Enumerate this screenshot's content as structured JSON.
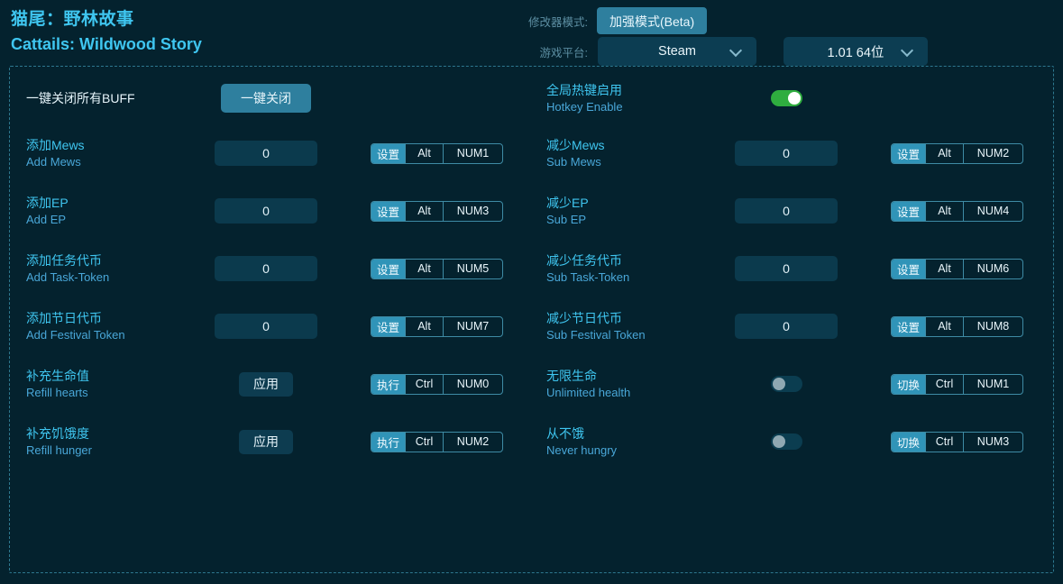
{
  "window": {
    "title_cn": "猫尾：野林故事",
    "title_en": "Cattails: Wildwood Story",
    "background": "#04222e",
    "accent": "#3fc6f0"
  },
  "header": {
    "mode_label": "修改器模式:",
    "mode_button": "加强模式(Beta)",
    "platform_label": "游戏平台:",
    "platform_value": "Steam",
    "version_value": "1.01 64位",
    "chevron_icon": "chevron-down-icon"
  },
  "panel": {
    "left": [
      {
        "type": "button",
        "label_cn": "一键关闭所有BUFF",
        "label_en": "",
        "single_line": true,
        "button": "一键关闭",
        "button_style": "primary",
        "hotkey": null
      },
      {
        "type": "input",
        "label_cn": "添加Mews",
        "label_en": "Add Mews",
        "value": "0",
        "hotkey": {
          "action": "设置",
          "mod": "Alt",
          "key": "NUM1"
        }
      },
      {
        "type": "input",
        "label_cn": "添加EP",
        "label_en": "Add EP",
        "value": "0",
        "hotkey": {
          "action": "设置",
          "mod": "Alt",
          "key": "NUM3"
        }
      },
      {
        "type": "input",
        "label_cn": "添加任务代币",
        "label_en": "Add Task-Token",
        "value": "0",
        "hotkey": {
          "action": "设置",
          "mod": "Alt",
          "key": "NUM5"
        }
      },
      {
        "type": "input",
        "label_cn": "添加节日代币",
        "label_en": "Add Festival Token",
        "value": "0",
        "hotkey": {
          "action": "设置",
          "mod": "Alt",
          "key": "NUM7"
        }
      },
      {
        "type": "button",
        "label_cn": "补充生命值",
        "label_en": "Refill hearts",
        "button": "应用",
        "button_style": "dark",
        "hotkey": {
          "action": "执行",
          "mod": "Ctrl",
          "key": "NUM0"
        }
      },
      {
        "type": "button",
        "label_cn": "补充饥饿度",
        "label_en": "Refill hunger",
        "button": "应用",
        "button_style": "dark",
        "hotkey": {
          "action": "执行",
          "mod": "Ctrl",
          "key": "NUM2"
        }
      }
    ],
    "right": [
      {
        "type": "switch",
        "label_cn": "全局热键启用",
        "label_en": "Hotkey Enable",
        "on": true,
        "hotkey": null
      },
      {
        "type": "input",
        "label_cn": "减少Mews",
        "label_en": "Sub Mews",
        "value": "0",
        "hotkey": {
          "action": "设置",
          "mod": "Alt",
          "key": "NUM2"
        }
      },
      {
        "type": "input",
        "label_cn": "减少EP",
        "label_en": "Sub EP",
        "value": "0",
        "hotkey": {
          "action": "设置",
          "mod": "Alt",
          "key": "NUM4"
        }
      },
      {
        "type": "input",
        "label_cn": "减少任务代币",
        "label_en": "Sub Task-Token",
        "value": "0",
        "hotkey": {
          "action": "设置",
          "mod": "Alt",
          "key": "NUM6"
        }
      },
      {
        "type": "input",
        "label_cn": "减少节日代币",
        "label_en": "Sub Festival Token",
        "value": "0",
        "hotkey": {
          "action": "设置",
          "mod": "Alt",
          "key": "NUM8"
        }
      },
      {
        "type": "switch",
        "label_cn": "无限生命",
        "label_en": "Unlimited health",
        "on": false,
        "hotkey": {
          "action": "切换",
          "mod": "Ctrl",
          "key": "NUM1"
        }
      },
      {
        "type": "switch",
        "label_cn": "从不饿",
        "label_en": "Never hungry",
        "on": false,
        "hotkey": {
          "action": "切换",
          "mod": "Ctrl",
          "key": "NUM3"
        }
      }
    ]
  }
}
